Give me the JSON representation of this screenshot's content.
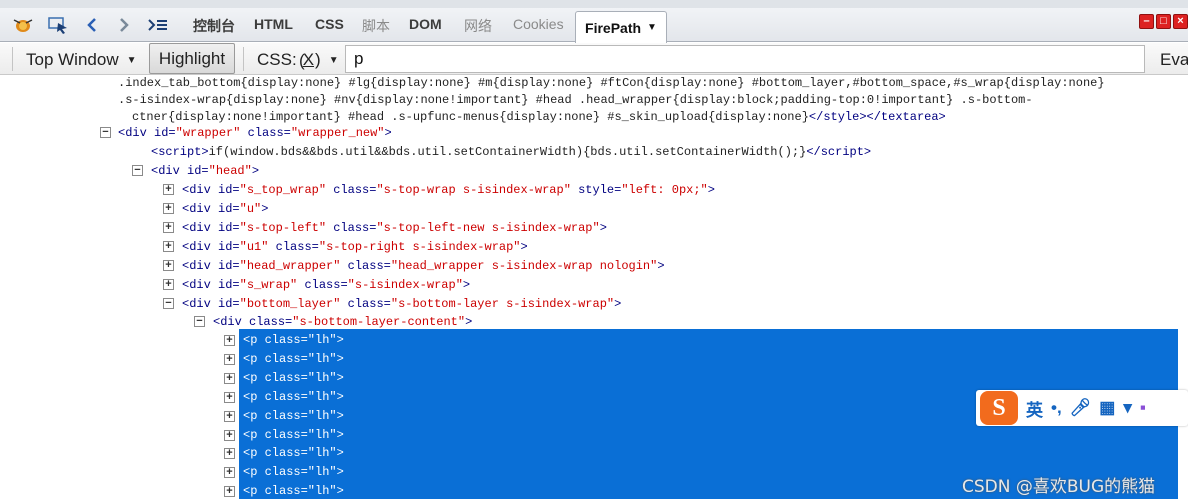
{
  "tabs": [
    {
      "label": "控制台",
      "dim": false
    },
    {
      "label": "HTML",
      "dim": false
    },
    {
      "label": "CSS",
      "dim": false
    },
    {
      "label": "脚本",
      "dim": true
    },
    {
      "label": "DOM",
      "dim": false
    },
    {
      "label": "网络",
      "dim": true
    },
    {
      "label": "Cookies",
      "dim": true
    }
  ],
  "active_tab": "FirePath",
  "toolbar": {
    "window_select": "Top Window",
    "highlight": "Highlight",
    "css_label": "CSS:",
    "css_shortcut": "X",
    "selector_value": "p",
    "eval_label": "Eva"
  },
  "tree_top": [
    ".index_tab_bottom{display:none} #lg{display:none} #m{display:none} #ftCon{display:none} #bottom_layer,#bottom_space,#s_wrap{display:none}",
    ".s-isindex-wrap{display:none} #nv{display:none!important} #head .head_wrapper{display:block;padding-top:0!important} .s-bottom-",
    "ctner{display:none!important} #head .s-upfunc-menus{display:none} #s_skin_upload{display:none}"
  ],
  "tree_top_close": "</style></textarea>",
  "wrapper": {
    "id": "wrapper",
    "class": "wrapper_new"
  },
  "script_line": "if(window.bds&&bds.util&&bds.util.setContainerWidth){bds.util.setContainerWidth();}",
  "head": {
    "id": "head"
  },
  "children": [
    {
      "id": "s_top_wrap",
      "class": "s-top-wrap s-isindex-wrap",
      "style": "left: 0px;"
    },
    {
      "id": "u"
    },
    {
      "id": "s-top-left",
      "class": "s-top-left-new s-isindex-wrap"
    },
    {
      "id": "u1",
      "class": "s-top-right s-isindex-wrap"
    },
    {
      "id": "head_wrapper",
      "class": "head_wrapper s-isindex-wrap nologin"
    },
    {
      "id": "s_wrap",
      "class": "s-isindex-wrap"
    },
    {
      "id": "bottom_layer",
      "class": "s-bottom-layer s-isindex-wrap"
    }
  ],
  "bottom_content_class": "s-bottom-layer-content",
  "p_rows": [
    "lh",
    "lh",
    "lh",
    "lh",
    "lh",
    "lh",
    "lh",
    "lh",
    "lh"
  ],
  "ime": {
    "lang": "英",
    "punct": "•,"
  },
  "watermark": "CSDN @喜欢BUG的熊猫",
  "colors": {
    "selection": "#0a6fd6",
    "tag": "#000080",
    "value": "#cc0000",
    "ime_logo": "#f26b1d"
  }
}
